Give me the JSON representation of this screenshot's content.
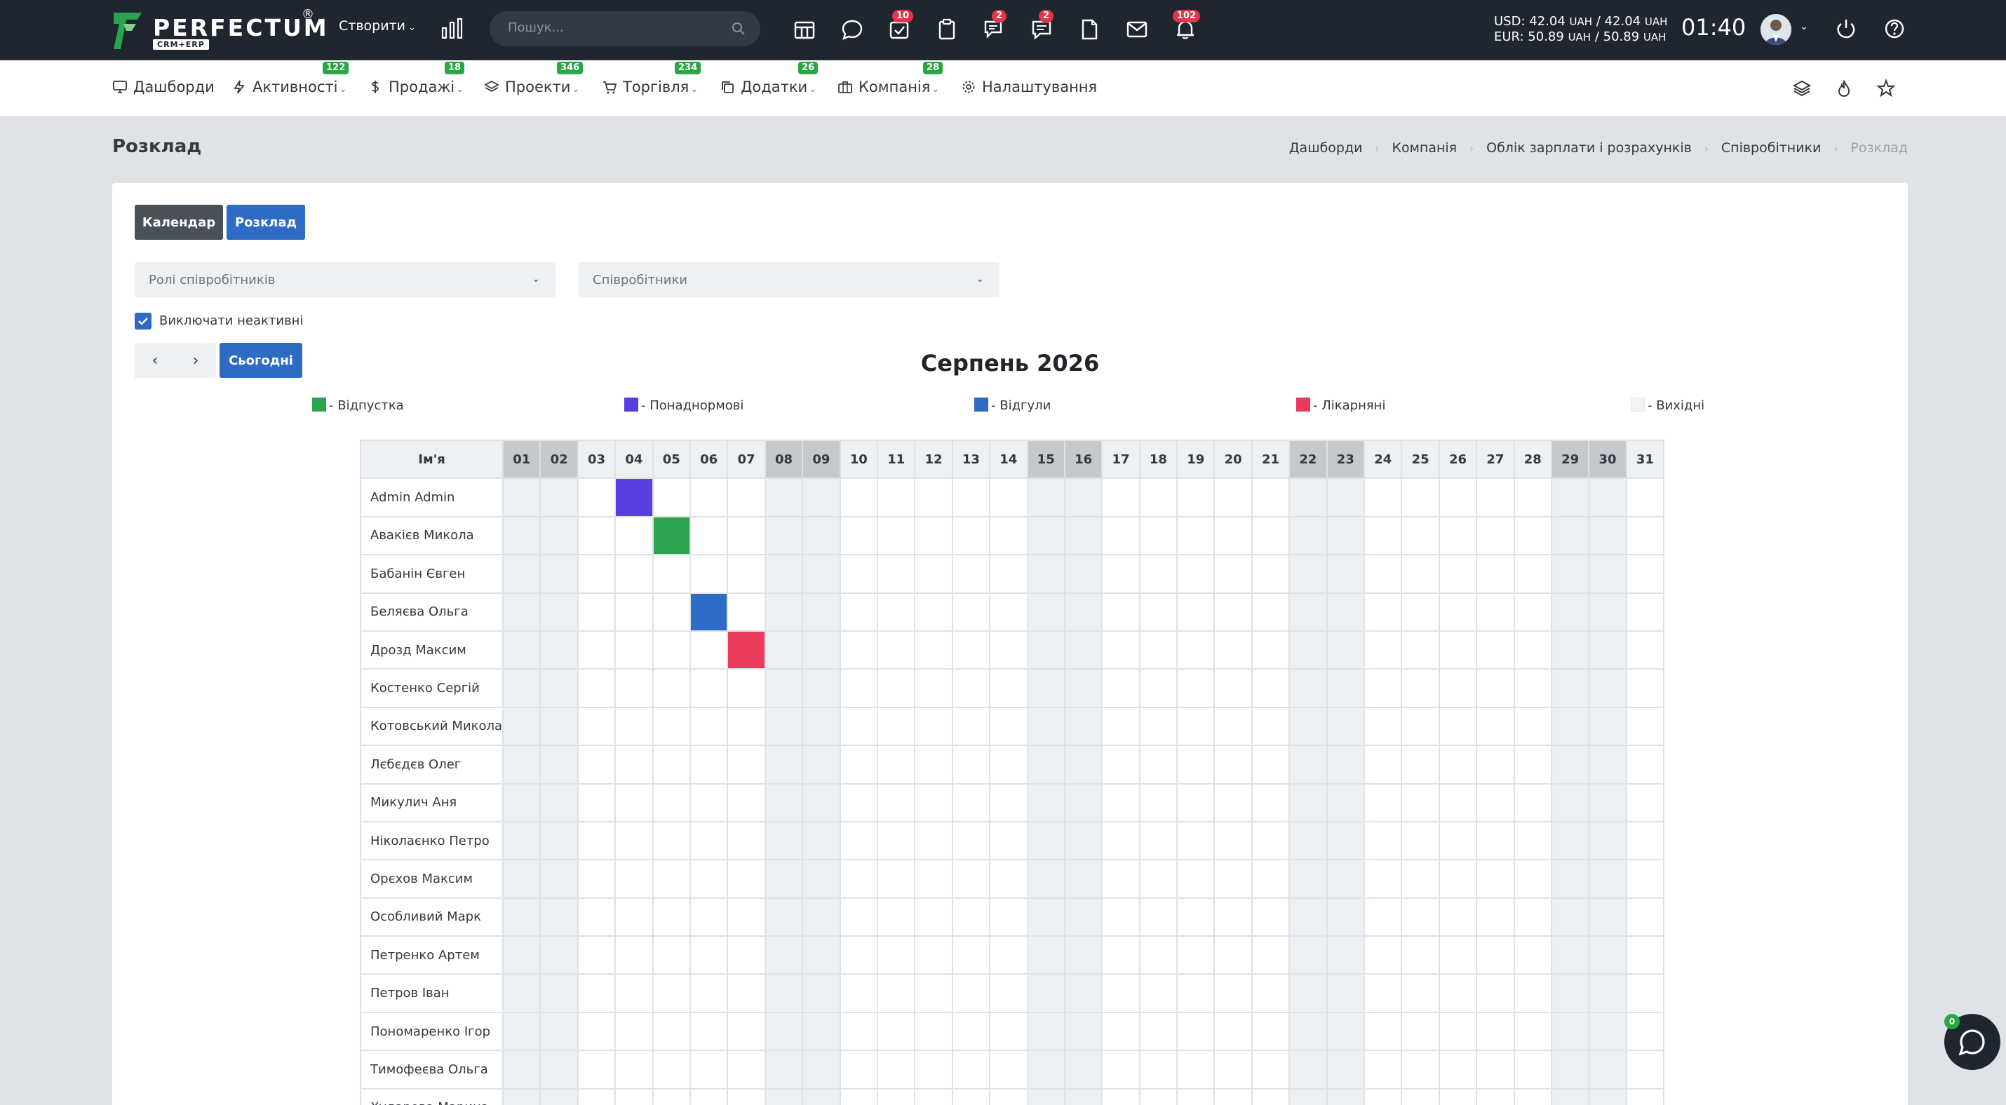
{
  "app": {
    "logo_text": "PERFECTUM",
    "logo_sub": "CRM+ERP",
    "logo_reg": "®",
    "create_label": "Створити",
    "search_placeholder": "Пошук...",
    "badges": {
      "tasks": "10",
      "chat": "2",
      "messages": "2",
      "notifications": "102"
    },
    "currency_usd": "USD: 42.04",
    "currency_usd_unit1": "UAH",
    "currency_usd_mid": "/ 42.04",
    "currency_usd_unit2": "UAH",
    "currency_eur": "EUR: 50.89",
    "currency_eur_unit1": "UAH",
    "currency_eur_mid": "/ 50.89",
    "currency_eur_unit2": "UAH",
    "clock": "01:40"
  },
  "nav": {
    "items": [
      {
        "label": "Дашборди",
        "badge": ""
      },
      {
        "label": "Активності",
        "badge": "122"
      },
      {
        "label": "Продажі",
        "badge": "18"
      },
      {
        "label": "Проекти",
        "badge": "346"
      },
      {
        "label": "Торгівля",
        "badge": "234"
      },
      {
        "label": "Додатки",
        "badge": "26"
      },
      {
        "label": "Компанія",
        "badge": "28"
      },
      {
        "label": "Налаштування",
        "badge": ""
      }
    ]
  },
  "page": {
    "title": "Розклад",
    "breadcrumb": [
      "Дашборди",
      "Компанія",
      "Облік зарплати і розрахунків",
      "Співробітники",
      "Розклад"
    ]
  },
  "toolbar": {
    "calendar_label": "Календар",
    "schedule_label": "Розклад",
    "roles_placeholder": "Ролі співробітників",
    "employees_placeholder": "Співробітники",
    "exclude_inactive_label": "Виключати неактивні",
    "prev_label": "‹",
    "next_label": "›",
    "today_label": "Сьогодні"
  },
  "calendar": {
    "month_title": "Серпень 2026",
    "legend": [
      {
        "label": "- Відпустка",
        "color": "#2aa44f"
      },
      {
        "label": "- Понаднормові",
        "color": "#5a3ee0"
      },
      {
        "label": "- Відгули",
        "color": "#2d6bc5"
      },
      {
        "label": "- Лікарняні",
        "color": "#e83a5a"
      },
      {
        "label": "- Вихідні",
        "color": "#f1f3f5"
      }
    ],
    "name_header": "Ім'я",
    "days": [
      "01",
      "02",
      "03",
      "04",
      "05",
      "06",
      "07",
      "08",
      "09",
      "10",
      "11",
      "12",
      "13",
      "14",
      "15",
      "16",
      "17",
      "18",
      "19",
      "20",
      "21",
      "22",
      "23",
      "24",
      "25",
      "26",
      "27",
      "28",
      "29",
      "30",
      "31"
    ],
    "weekend_days": [
      "01",
      "02",
      "08",
      "09",
      "15",
      "16",
      "22",
      "23",
      "29",
      "30"
    ],
    "employees": [
      {
        "name": "Admin Admin",
        "marks": [
          {
            "day": "04",
            "type": "- Понаднормові"
          }
        ]
      },
      {
        "name": "Авакієв Микола",
        "marks": [
          {
            "day": "05",
            "type": "- Відпустка"
          }
        ]
      },
      {
        "name": "Бабанін Євген",
        "marks": []
      },
      {
        "name": "Беляєва Ольга",
        "marks": [
          {
            "day": "06",
            "type": "- Відгули"
          }
        ]
      },
      {
        "name": "Дрозд Максим",
        "marks": [
          {
            "day": "07",
            "type": "- Лікарняні"
          }
        ]
      },
      {
        "name": "Костенко Сергій",
        "marks": []
      },
      {
        "name": "Котовський Микола",
        "marks": []
      },
      {
        "name": "Лєбєдєв Олег",
        "marks": []
      },
      {
        "name": "Микулич Аня",
        "marks": []
      },
      {
        "name": "Ніколаєнко Петро",
        "marks": []
      },
      {
        "name": "Орєхов Максим",
        "marks": []
      },
      {
        "name": "Особливий Марк",
        "marks": []
      },
      {
        "name": "Петренко Артем",
        "marks": []
      },
      {
        "name": "Петров Іван",
        "marks": []
      },
      {
        "name": "Пономаренко Ігор",
        "marks": []
      },
      {
        "name": "Тимофеєва Ольга",
        "marks": []
      },
      {
        "name": "Хударова Марина",
        "marks": []
      }
    ]
  },
  "chat": {
    "badge": "0"
  }
}
